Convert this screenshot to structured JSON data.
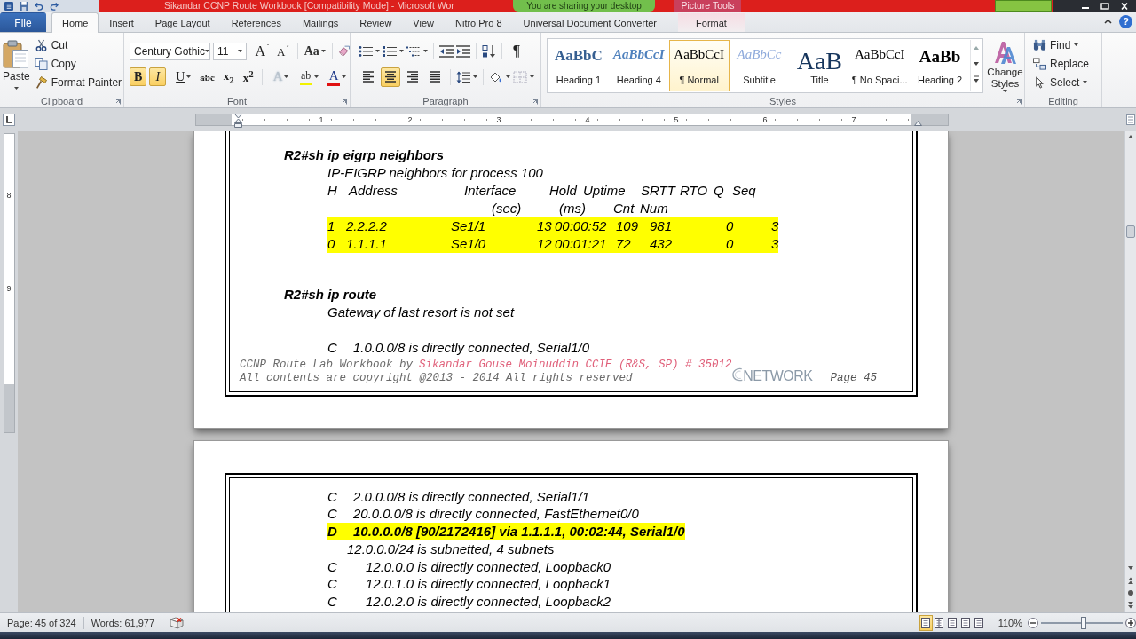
{
  "title_bar": {
    "title": "Sikandar CCNP Route Workbook [Compatibility Mode] - Microsoft Wor",
    "sharing_banner": "You are sharing your desktop",
    "context_label": "Picture Tools"
  },
  "tabs": [
    {
      "label": "File",
      "kind": "file",
      "selected": false
    },
    {
      "label": "Home",
      "kind": "standard",
      "selected": true
    },
    {
      "label": "Insert",
      "kind": "standard",
      "selected": false
    },
    {
      "label": "Page Layout",
      "kind": "standard",
      "selected": false
    },
    {
      "label": "References",
      "kind": "standard",
      "selected": false
    },
    {
      "label": "Mailings",
      "kind": "standard",
      "selected": false
    },
    {
      "label": "Review",
      "kind": "standard",
      "selected": false
    },
    {
      "label": "View",
      "kind": "standard",
      "selected": false
    },
    {
      "label": "Nitro Pro 8",
      "kind": "standard",
      "selected": false
    },
    {
      "label": "Universal Document Converter",
      "kind": "standard",
      "selected": false
    },
    {
      "label": "Format",
      "kind": "contextual",
      "selected": false
    }
  ],
  "help": "?",
  "ribbon": {
    "clipboard": {
      "label": "Clipboard",
      "paste": "Paste",
      "actions": [
        {
          "kind": "cut",
          "label": "Cut"
        },
        {
          "kind": "copy",
          "label": "Copy"
        },
        {
          "kind": "painter",
          "label": "Format Painter"
        }
      ]
    },
    "font": {
      "label": "Font",
      "font_name": "Century Gothic",
      "font_size": "11",
      "size_buttons": [
        {
          "kind": "grow",
          "glyph": "A"
        },
        {
          "kind": "shrink",
          "glyph": "A"
        }
      ],
      "change_case": "Aa",
      "format_buttons": [
        {
          "kind": "bold",
          "glyph": "B",
          "selected": true
        },
        {
          "kind": "italic",
          "glyph": "I",
          "selected": true
        },
        {
          "kind": "underline",
          "glyph": "U",
          "selected": false
        },
        {
          "kind": "strike",
          "glyph": "abc",
          "selected": false
        },
        {
          "kind": "subscript",
          "glyph": "x$_{2}$",
          "selected": false
        },
        {
          "kind": "superscript",
          "glyph": "x$^{2}$",
          "selected": false
        }
      ],
      "color_buttons": [
        {
          "kind": "effects",
          "glyph": "A"
        },
        {
          "kind": "highlight",
          "glyph": "ab",
          "color": "#f2f200"
        },
        {
          "kind": "fontcolor",
          "glyph": "A",
          "color": "#e01010"
        }
      ]
    },
    "paragraph": {
      "label": "Paragraph",
      "marks": "¶",
      "align_buttons": [
        {
          "kind": "left",
          "selected": false
        },
        {
          "kind": "center",
          "selected": true
        },
        {
          "kind": "right",
          "selected": false
        },
        {
          "kind": "justify",
          "selected": false
        }
      ]
    },
    "styles": {
      "label": "Styles",
      "change_styles": "Change Styles",
      "items": [
        {
          "sample": "AaBbC",
          "name": "Heading 1",
          "kind": "heading1",
          "selected": false
        },
        {
          "sample": "AaBbCcI",
          "name": "Heading 4",
          "kind": "heading4",
          "selected": false
        },
        {
          "sample": "AaBbCcI",
          "name": "¶ Normal",
          "kind": "normal",
          "selected": true
        },
        {
          "sample": "AaBbCc",
          "name": "Subtitle",
          "kind": "subtitle",
          "selected": false
        },
        {
          "sample": "AaB",
          "name": "Title",
          "kind": "title",
          "selected": false
        },
        {
          "sample": "AaBbCcI",
          "name": "¶ No Spaci...",
          "kind": "nospacing",
          "selected": false
        },
        {
          "sample": "AaBb",
          "name": "Heading 2",
          "kind": "heading2",
          "selected": false
        }
      ]
    },
    "editing": {
      "label": "Editing",
      "actions": [
        {
          "kind": "find",
          "label": "Find"
        },
        {
          "kind": "replace",
          "label": "Replace"
        },
        {
          "kind": "select",
          "label": "Select"
        }
      ]
    }
  },
  "ruler": {
    "numbers": [
      "1",
      "2",
      "3",
      "4",
      "5",
      "6",
      "7"
    ]
  },
  "vertical_ruler": {
    "numbers": [
      "8",
      "9"
    ]
  },
  "document": {
    "pages": [
      {
        "blocks": [
          {
            "kind": "command",
            "text": "R2#sh ip eigrp neighbors"
          },
          {
            "kind": "line",
            "text": "IP-EIGRP neighbors for process 100"
          },
          {
            "kind": "table",
            "header": [
              [
                "H",
                "Address",
                "Interface",
                "Hold",
                "Uptime",
                "SRTT",
                "RTO",
                "Q",
                "Seq"
              ],
              [
                "(sec)",
                "(ms)",
                "Cnt",
                "Num"
              ]
            ],
            "rows": [
              {
                "cells": [
                  "1",
                  "2.2.2.2",
                  "Se1/1",
                  "13",
                  "00:00:52",
                  "109",
                  "981",
                  "0",
                  "3"
                ],
                "highlighted": true
              },
              {
                "cells": [
                  "0",
                  "1.1.1.1",
                  "Se1/0",
                  "12",
                  "00:01:21",
                  "72",
                  "432",
                  "0",
                  "3"
                ],
                "highlighted": true
              }
            ]
          },
          {
            "kind": "command",
            "text": "R2#sh ip route"
          },
          {
            "kind": "line",
            "text": "Gateway of last resort is not set"
          },
          {
            "kind": "route",
            "code": "C",
            "text": "1.0.0.0/8 is directly connected, Serial1/0",
            "highlighted": false
          }
        ],
        "footer": {
          "credit": "CCNP Route Lab Workbook by",
          "author": "Sikandar Gouse Moinuddin CCIE (R&S, SP) # 35012",
          "copyright": "All contents are copyright @2013 - 2014 All rights reserved",
          "logo": "NETWORK",
          "page": "Page 45"
        }
      },
      {
        "blocks": [
          {
            "kind": "route",
            "code": "C",
            "text": "2.0.0.0/8 is directly connected, Serial1/1",
            "highlighted": false
          },
          {
            "kind": "route",
            "code": "C",
            "text": "20.0.0.0/8 is directly connected, FastEthernet0/0",
            "highlighted": false
          },
          {
            "kind": "route",
            "code": "D",
            "text": "10.0.0.0/8 [90/2172416] via 1.1.1.1, 00:02:44, Serial1/0",
            "highlighted": true
          },
          {
            "kind": "subnet",
            "text": "12.0.0.0/24 is subnetted, 4 subnets",
            "children": [
              {
                "code": "C",
                "text": "12.0.0.0 is directly connected, Loopback0",
                "highlighted": false
              },
              {
                "code": "C",
                "text": "12.0.1.0 is directly connected, Loopback1",
                "highlighted": false
              },
              {
                "code": "C",
                "text": "12.0.2.0 is directly connected, Loopback2",
                "highlighted": false
              }
            ]
          }
        ]
      }
    ]
  },
  "status_bar": {
    "page": "Page: 45 of 324",
    "words": "Words: 61,977",
    "views": [
      {
        "kind": "print",
        "selected": true
      },
      {
        "kind": "reading",
        "selected": false
      },
      {
        "kind": "web",
        "selected": false
      },
      {
        "kind": "outline",
        "selected": false
      },
      {
        "kind": "draft",
        "selected": false
      }
    ],
    "zoom": "110%",
    "zoom_slider": {
      "level": 0.52
    }
  }
}
